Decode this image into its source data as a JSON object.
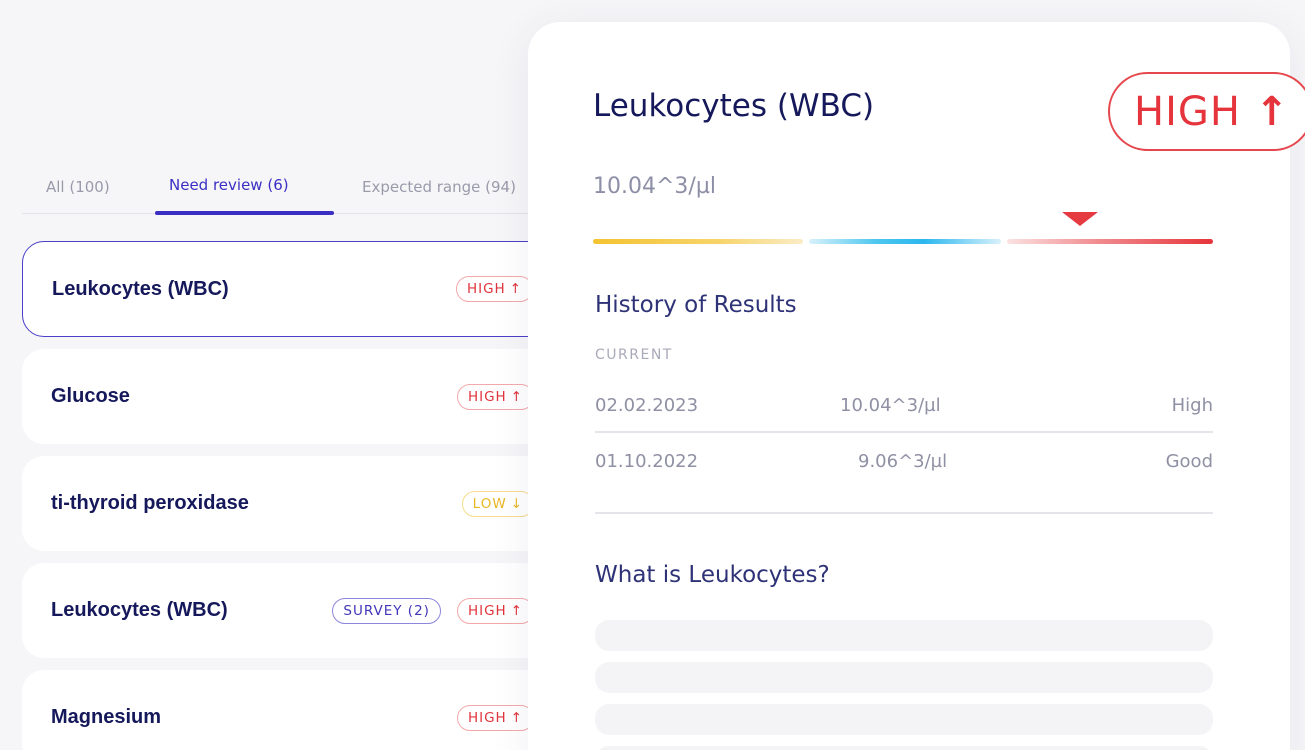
{
  "tabs": [
    {
      "label": "All (100)"
    },
    {
      "label": "Need review (6)"
    },
    {
      "label": "Expected range (94)"
    }
  ],
  "results": [
    {
      "name": "Leukocytes (WBC)",
      "status": "HIGH",
      "arrow": "↑",
      "selected": true
    },
    {
      "name": "Glucose",
      "status": "HIGH",
      "arrow": "↑"
    },
    {
      "name": "ti-thyroid peroxidase",
      "status": "LOW",
      "arrow": "↓"
    },
    {
      "name": "Leukocytes (WBC)",
      "survey": "SURVEY (2)",
      "status": "HIGH",
      "arrow": "↑"
    },
    {
      "name": "Magnesium",
      "status": "HIGH",
      "arrow": "↑"
    }
  ],
  "detail": {
    "title": "Leukocytes (WBC)",
    "badge": "HIGH",
    "badge_arrow": "↑",
    "value": "10.04^3/µl",
    "range_position": 0.785
  },
  "history": {
    "title": "History of Results",
    "current_label": "CURRENT",
    "rows": [
      {
        "date": "02.02.2023",
        "value": "10.04^3/µl",
        "status": "High"
      },
      {
        "date": "01.10.2022",
        "value": "9.06^3/µl",
        "status": "Good"
      }
    ]
  },
  "about": {
    "title": "What is Leukocytes?"
  },
  "colors": {
    "accent": "#3a2fc2",
    "high": "#e5343c",
    "low": "#e9b625",
    "navy": "#15185a"
  }
}
